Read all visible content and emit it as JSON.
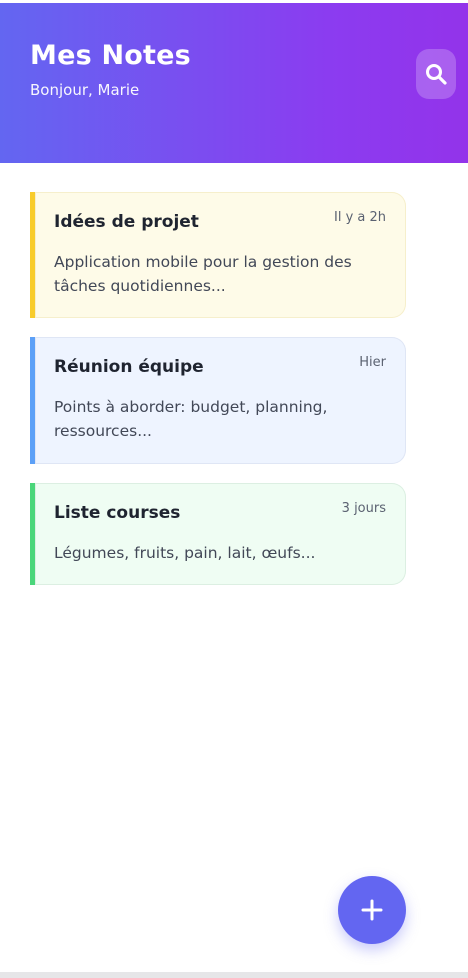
{
  "header": {
    "title": "Mes Notes",
    "greeting": "Bonjour, Marie",
    "search_icon": "search-icon",
    "gradient_start": "#6366f1",
    "gradient_end": "#9333ea"
  },
  "notes": [
    {
      "title": "Idées de projet",
      "time": "Il y a 2h",
      "body": "Application mobile pour la gestion des tâches quotidiennes...",
      "accent": "#f8cc2b",
      "background": "#fefbe8"
    },
    {
      "title": "Réunion équipe",
      "time": "Hier",
      "body": "Points à aborder: budget, planning, ressources...",
      "accent": "#5ca0f7",
      "background": "#eef4ff"
    },
    {
      "title": "Liste courses",
      "time": "3 jours",
      "body": "Légumes, fruits, pain, lait, œufs...",
      "accent": "#4ad67a",
      "background": "#effdf3"
    }
  ],
  "fab": {
    "icon": "plus-icon",
    "color": "#6366f1"
  }
}
